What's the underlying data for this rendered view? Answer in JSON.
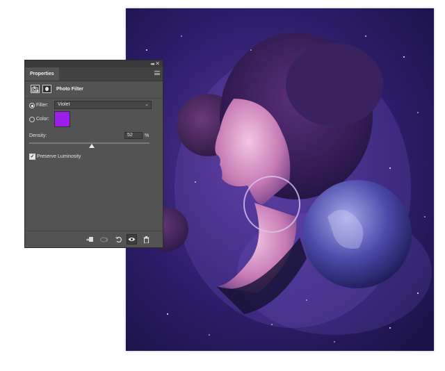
{
  "panel": {
    "tab_label": "Properties",
    "title": "Photo Filter",
    "filter": {
      "label": "Filter:",
      "selected": "Violet",
      "chevron": "chevron-down-icon"
    },
    "color": {
      "label": "Color:",
      "value": "#9b1fe8"
    },
    "density": {
      "label": "Density:",
      "value": "52",
      "unit": "%",
      "fraction": 0.52
    },
    "preserve_luminosity": {
      "label": "Preserve Luminosity",
      "checked": true
    },
    "footer_icons": [
      "clip-to-layer-icon",
      "view-previous-icon",
      "reset-icon",
      "visibility-eye-icon",
      "trash-icon"
    ]
  },
  "colors": {
    "panel_bg": "#535353",
    "tab_bar_bg": "#424242",
    "canvas_bg": "#2a1a5e",
    "accent_violet": "#9b1fe8"
  }
}
